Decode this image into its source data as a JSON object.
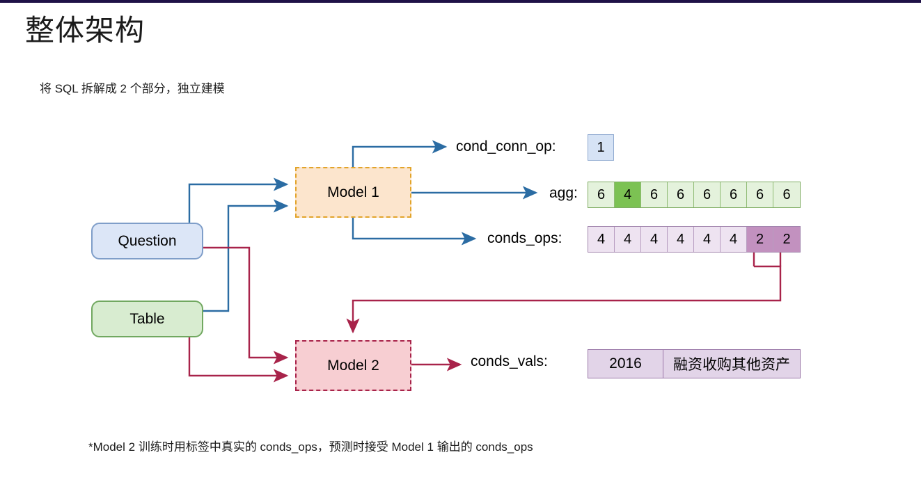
{
  "slide": {
    "title": "整体架构",
    "subtitle": "将 SQL 拆解成 2 个部分，独立建模",
    "footnote": "*Model 2 训练时用标签中真实的 conds_ops，预测时接受 Model 1 输出的 conds_ops",
    "accent_bar_color": "#1f1147"
  },
  "nodes": {
    "question": {
      "label": "Question",
      "fill": "#dce6f7",
      "border": "#7f9ec9"
    },
    "table": {
      "label": "Table",
      "fill": "#d8ecd0",
      "border": "#71a860"
    },
    "model1": {
      "label": "Model 1",
      "fill": "#fce5cd",
      "border": "#e2a42a"
    },
    "model2": {
      "label": "Model 2",
      "fill": "#f7ced2",
      "border": "#a8234a"
    }
  },
  "outputs": {
    "cond_conn_op": {
      "label": "cond_conn_op:",
      "cells": [
        "1"
      ],
      "highlight_indices": [],
      "fill": "#d6e3f5",
      "border": "#8ea9d0"
    },
    "agg": {
      "label": "agg:",
      "cells": [
        "6",
        "4",
        "6",
        "6",
        "6",
        "6",
        "6",
        "6"
      ],
      "highlight_indices": [
        1
      ],
      "fill": "#e4f2dc",
      "highlight_fill": "#7cc253",
      "border": "#7fad63"
    },
    "conds_ops": {
      "label": "conds_ops:",
      "cells": [
        "4",
        "4",
        "4",
        "4",
        "4",
        "4",
        "2",
        "2"
      ],
      "highlight_indices": [
        6,
        7
      ],
      "fill": "#eee3f1",
      "highlight_fill": "#c291bf",
      "border": "#a184ad"
    },
    "conds_vals": {
      "label": "conds_vals:",
      "cells": [
        "2016",
        "融资收购其他资产"
      ],
      "highlight_indices": [],
      "fill": "#e2d4e8",
      "border": "#9a77a8"
    }
  },
  "edge_colors": {
    "blue": "#2b6ca3",
    "crimson": "#a8234a"
  }
}
